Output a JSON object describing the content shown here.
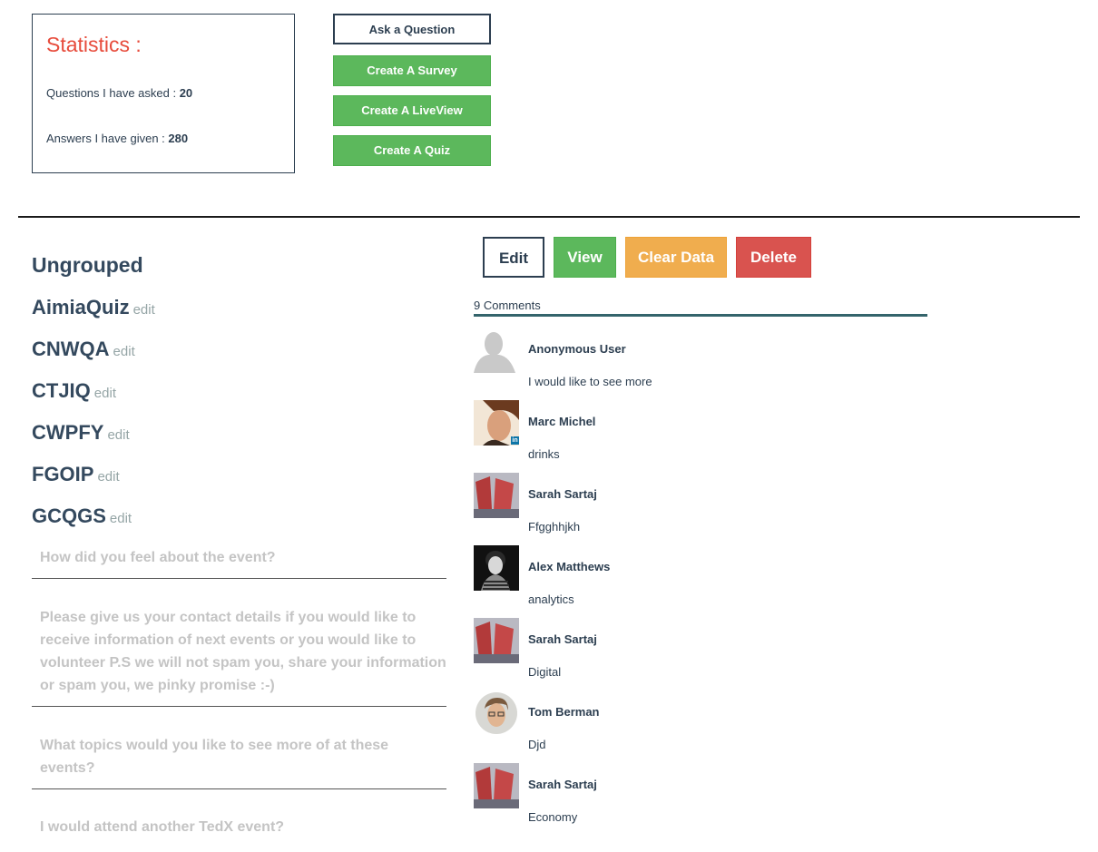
{
  "stats": {
    "title": "Statistics :",
    "asked_label": "Questions I have asked : ",
    "asked_value": "20",
    "given_label": "Answers I have given : ",
    "given_value": "280"
  },
  "actions": {
    "ask": "Ask a Question",
    "survey": "Create A Survey",
    "liveview": "Create A LiveView",
    "quiz": "Create A Quiz"
  },
  "left": {
    "group_heading": "Ungrouped",
    "quizzes": [
      {
        "name": "AimiaQuiz",
        "edit": "edit"
      },
      {
        "name": "CNWQA",
        "edit": "edit"
      },
      {
        "name": "CTJIQ",
        "edit": "edit"
      },
      {
        "name": "CWPFY",
        "edit": "edit"
      },
      {
        "name": "FGOIP",
        "edit": "edit"
      },
      {
        "name": "GCQGS",
        "edit": "edit"
      }
    ],
    "questions": [
      "How did you feel about the event?",
      "Please give us your contact details if you would like to receive information of next events or you would like to volunteer  P.S we will not spam you, share your information or spam you, we pinky promise :-)",
      "What topics would you like to see more of at these events?",
      "I would attend another TedX event?"
    ]
  },
  "toolbar": {
    "edit": "Edit",
    "view": "View",
    "clear": "Clear Data",
    "delete": "Delete"
  },
  "comments": {
    "count_label": "9 Comments",
    "items": [
      {
        "author": "Anonymous User",
        "text": "I would like to see more",
        "avatar": "silhouette"
      },
      {
        "author": "Marc Michel",
        "text": "drinks",
        "avatar": "photo-portrait",
        "linkedin": "in"
      },
      {
        "author": "Sarah Sartaj",
        "text": "Ffgghhjkh",
        "avatar": "photo-red"
      },
      {
        "author": "Alex Matthews",
        "text": "analytics",
        "avatar": "photo-dark"
      },
      {
        "author": "Sarah Sartaj",
        "text": "Digital",
        "avatar": "photo-red"
      },
      {
        "author": "Tom Berman",
        "text": "Djd",
        "avatar": "photo-round"
      },
      {
        "author": "Sarah Sartaj",
        "text": "Economy",
        "avatar": "photo-red"
      }
    ]
  }
}
